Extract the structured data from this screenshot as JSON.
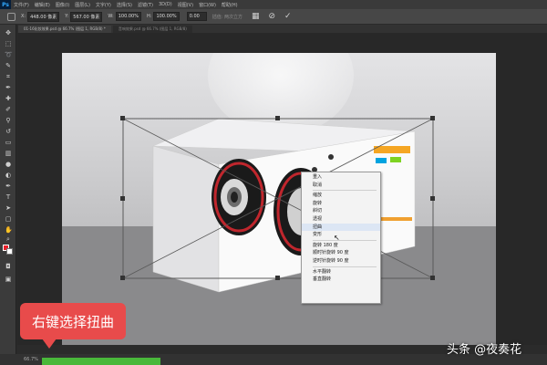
{
  "app": {
    "logo": "Ps"
  },
  "menu": [
    "文件(F)",
    "编辑(E)",
    "图像(I)",
    "图层(L)",
    "文字(Y)",
    "选择(S)",
    "滤镜(T)",
    "3D(D)",
    "视图(V)",
    "窗口(W)",
    "帮助(H)"
  ],
  "options": {
    "x_label": "X:",
    "x_value": "448.00 像素",
    "y_label": "Y:",
    "y_value": "567.00 像素",
    "w_label": "W:",
    "w_value": "100.00%",
    "h_label": "H:",
    "h_value": "100.00%",
    "angle_value": "0.00",
    "interp_label": "插值: 两次立方",
    "cancel_glyph": "⊘",
    "commit_glyph": "✓"
  },
  "tabs": [
    {
      "label": "01-16化妆效果.psd @ 66.7% (图层 1, RGB/8) *",
      "active": true
    },
    {
      "label": "音响效果.psd @ 66.7% (图层 1, RGB/8)",
      "active": false
    }
  ],
  "context_menu": {
    "items": [
      {
        "label": "重入",
        "hover": false
      },
      {
        "label": "取消",
        "hover": false
      },
      {
        "sep": true
      },
      {
        "label": "缩放",
        "hover": false
      },
      {
        "label": "旋转",
        "hover": false
      },
      {
        "label": "斜切",
        "hover": false
      },
      {
        "label": "透视",
        "hover": false
      },
      {
        "label": "扭曲",
        "hover": true
      },
      {
        "label": "变形",
        "hover": false
      },
      {
        "sep": true
      },
      {
        "label": "旋转 180 度",
        "hover": false
      },
      {
        "label": "顺时针旋转 90 度",
        "hover": false
      },
      {
        "label": "逆时针旋转 90 度",
        "hover": false
      },
      {
        "sep": true
      },
      {
        "label": "水平翻转",
        "hover": false
      },
      {
        "label": "垂直翻转",
        "hover": false
      }
    ]
  },
  "callout": {
    "text": "右键选择扭曲"
  },
  "statusbar": {
    "zoom": "66.7%"
  },
  "watermark": {
    "text": "头条 @夜奏花"
  },
  "colors": {
    "foreground": "#e8202a",
    "background": "#ffffff",
    "callout": "#e84b4b"
  }
}
